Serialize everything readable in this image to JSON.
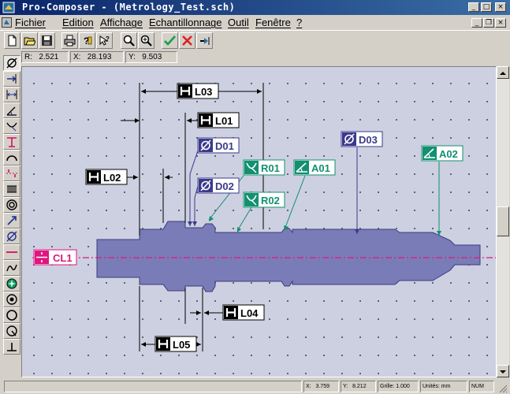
{
  "window": {
    "title": "Pro-Composer - (Metrology_Test.sch)"
  },
  "menu": {
    "items": [
      {
        "id": "fichier",
        "label": "Fichier"
      },
      {
        "id": "edition",
        "label": "Edition"
      },
      {
        "id": "affichage",
        "label": "Affichage"
      },
      {
        "id": "echantillonnage",
        "label": "Echantillonnage"
      },
      {
        "id": "outil",
        "label": "Outil"
      },
      {
        "id": "fenetre",
        "label": "Fenêtre"
      },
      {
        "id": "help",
        "label": "?"
      }
    ]
  },
  "toolbar": {
    "icons": [
      "new-file",
      "open-folder",
      "save-disk",
      "print",
      "help-query",
      "context-help",
      "zoom-fit",
      "zoom-in",
      "validate-check",
      "cancel-cross",
      "probe-execute"
    ]
  },
  "coords_top": {
    "r_label": "R:",
    "r_value": "2.521",
    "x_label": "X:",
    "x_value": "28.193",
    "y_label": "Y:",
    "y_value": "9.503"
  },
  "left_tools": [
    "diameter",
    "point-arrow",
    "distance",
    "angle",
    "radius",
    "perpendicular",
    "arc",
    "symmetry",
    "thread",
    "concentric",
    "direction",
    "diameter-2",
    "line",
    "spline",
    "circle",
    "ring",
    "circle-large",
    "cylinder",
    "flatness"
  ],
  "drawing": {
    "labels": {
      "L01": "L01",
      "L02": "L02",
      "L03": "L03",
      "L04": "L04",
      "L05": "L05",
      "D01": "D01",
      "D02": "D02",
      "D03": "D03",
      "R01": "R01",
      "R02": "R02",
      "A01": "A01",
      "A02": "A02",
      "CL1": "CL1"
    },
    "colors": {
      "part": "#7a7cb8",
      "dim_black": "#000000",
      "dim_blue": "#3a3a8c",
      "dim_teal": "#129070",
      "centerline": "#e0157f",
      "canvas": "#cdd0e0"
    }
  },
  "status": {
    "x_label": "X:",
    "x_value": "3.759",
    "y_label": "Y:",
    "y_value": "8.212",
    "grid_label": "Grille:",
    "grid_value": "1.000",
    "units_label": "Unités:",
    "units_value": "mm",
    "mode": "NUM"
  }
}
